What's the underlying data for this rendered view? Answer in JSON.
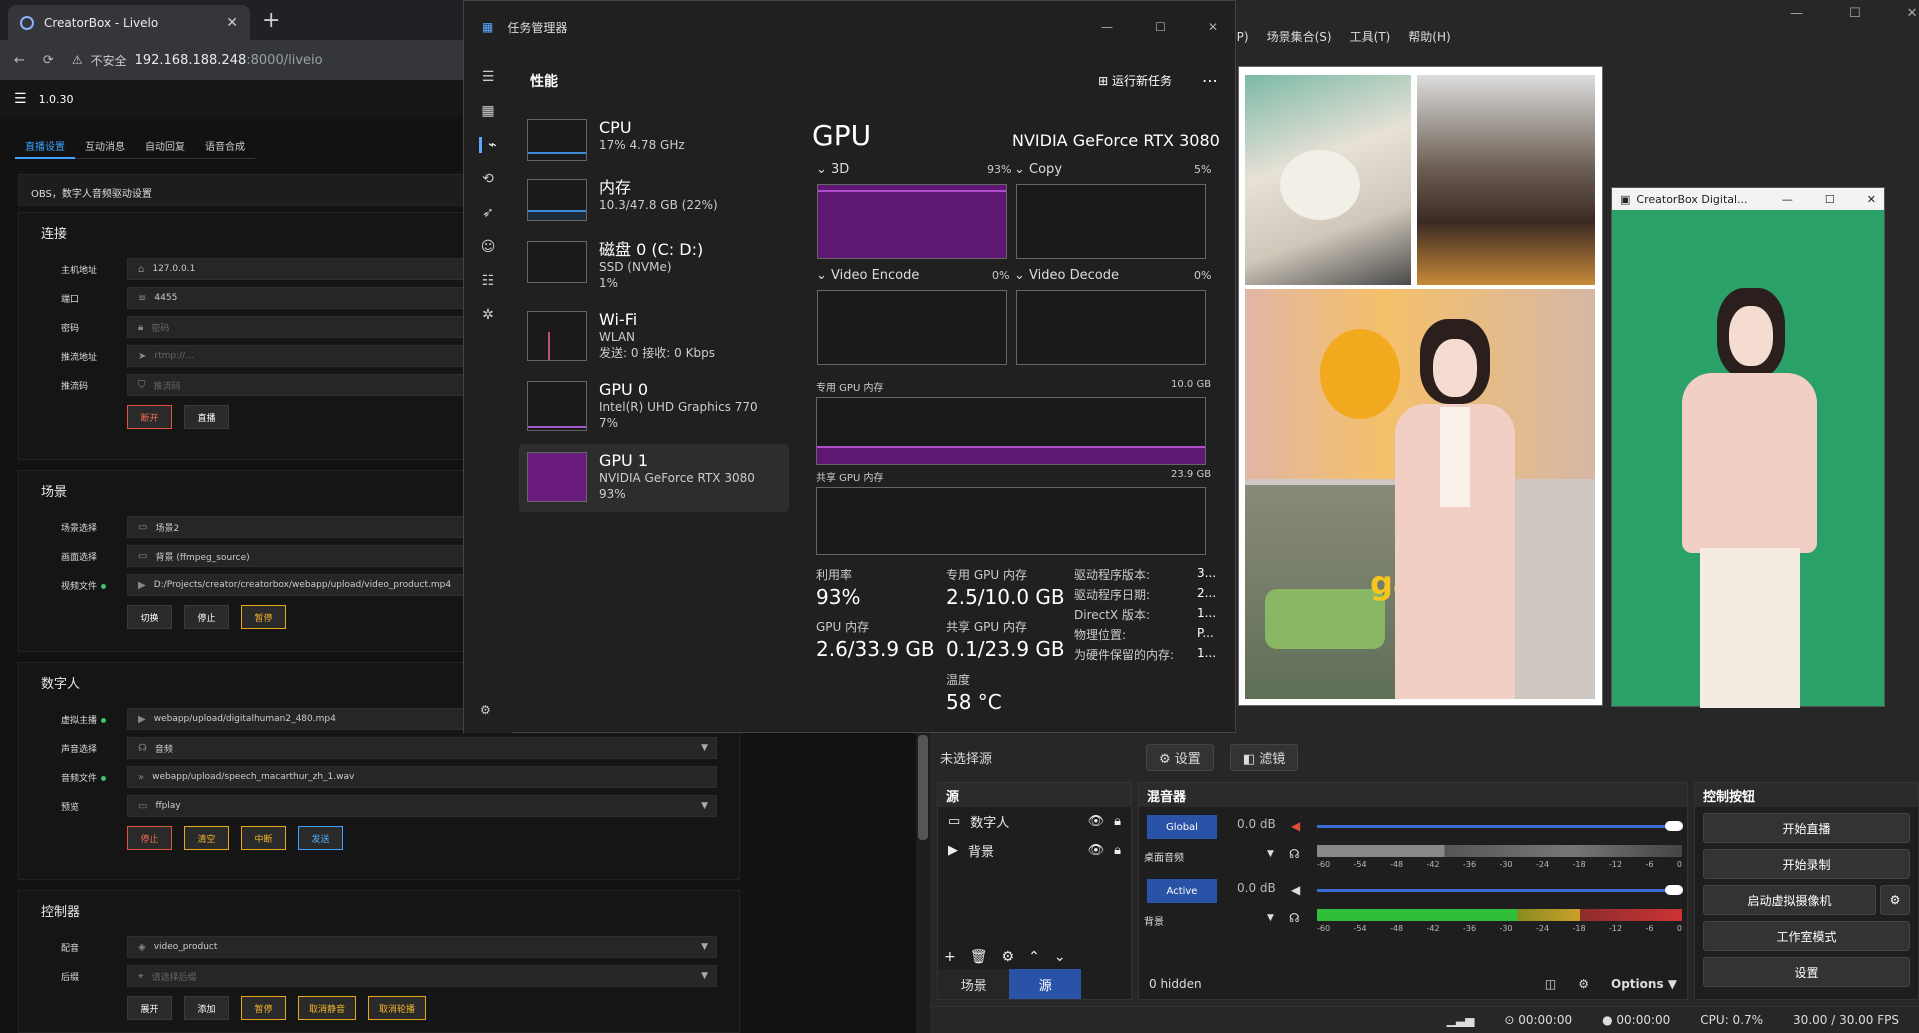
{
  "browser": {
    "tab_title": "CreatorBox - Livelo",
    "address_warning": "不安全",
    "address_host": "192.168.188.248",
    "address_path": ":8000/liveio"
  },
  "app": {
    "version": "1.0.30",
    "tabs": [
      "直播设置",
      "互动消息",
      "自动回复",
      "语音合成"
    ],
    "obs_note": "OBS，数字人音频驱动设置",
    "connection": {
      "title": "连接",
      "host_label": "主机地址",
      "host_value": "127.0.0.1",
      "port_label": "端口",
      "port_value": "4455",
      "password_label": "密码",
      "password_placeholder": "密码",
      "push_url_label": "推流地址",
      "push_url_placeholder": "rtmp://...",
      "push_code_label": "推流码",
      "push_code_placeholder": "推流码",
      "btn_disconnect": "断开",
      "btn_live": "直播"
    },
    "scene": {
      "title": "场景",
      "scene_select_label": "场景选择",
      "scene_select_value": "场景2",
      "frame_select_label": "画面选择",
      "frame_select_value": "背景 (ffmpeg_source)",
      "video_file_label": "视频文件",
      "video_file_value": "D:/Projects/creator/creatorbox/webapp/upload/video_product.mp4",
      "btn_switch": "切换",
      "btn_stop": "停止",
      "btn_pause": "暂停"
    },
    "digital_human": {
      "title": "数字人",
      "anchor_label": "虚拟主播",
      "anchor_value": "webapp/upload/digitalhuman2_480.mp4",
      "voice_label": "声音选择",
      "voice_value": "音频",
      "audio_file_label": "音频文件",
      "audio_file_value": "webapp/upload/speech_macarthur_zh_1.wav",
      "preview_label": "预览",
      "preview_value": "ffplay",
      "btn_stop": "停止",
      "btn_clear": "清空",
      "btn_interrupt": "中断",
      "btn_send": "发送"
    },
    "controller": {
      "title": "控制器",
      "dub_label": "配音",
      "dub_value": "video_product",
      "bg_label": "后缀",
      "bg_placeholder": "请选择后缀",
      "btn_expand": "展开",
      "btn_add": "添加",
      "btn_pause": "暂停",
      "btn_unmute": "取消静音",
      "btn_cancel_loop": "取消轮播"
    }
  },
  "obs": {
    "menu": [
      "件(P)",
      "场景集合(S)",
      "工具(T)",
      "帮助(H)"
    ],
    "unselected_source": "未选择源",
    "btn_settings": "设置",
    "btn_filters": "滤镜",
    "sources_title": "源",
    "sources": [
      {
        "name": "数字人",
        "icon": "monitor-icon"
      },
      {
        "name": "背景",
        "icon": "play-icon"
      }
    ],
    "tab_scenes": "场景",
    "tab_sources": "源",
    "mixer_title": "混音器",
    "mixer": [
      {
        "badge": "Global",
        "db": "0.0 dB",
        "name": "桌面音频"
      },
      {
        "badge": "Active",
        "db": "0.0 dB",
        "name": "背景"
      }
    ],
    "meter_scale": [
      "-60",
      "-54",
      "-48",
      "-42",
      "-36",
      "-30",
      "-24",
      "-18",
      "-12",
      "-6",
      "0"
    ],
    "hidden_count": "0 hidden",
    "options_label": "Options",
    "controls_title": "控制按钮",
    "controls": [
      "开始直播",
      "开始录制",
      "启动虚拟摄像机",
      "工作室模式",
      "设置"
    ],
    "status": {
      "stream_time": "00:00:00",
      "rec_time": "00:00:00",
      "cpu": "CPU: 0.7%",
      "fps": "30.00 / 30.00 FPS"
    },
    "vcam_title": "CreatorBox Digital...",
    "preview_overlay_text": "gad"
  },
  "taskmanager": {
    "title": "任务管理器",
    "section": "性能",
    "run_new_task": "运行新任务",
    "items": [
      {
        "name": "CPU",
        "sub1": "17% 4.78 GHz",
        "sub2": ""
      },
      {
        "name": "内存",
        "sub1": "10.3/47.8 GB (22%)",
        "sub2": ""
      },
      {
        "name": "磁盘 0 (C: D:)",
        "sub1": "SSD (NVMe)",
        "sub2": "1%"
      },
      {
        "name": "Wi-Fi",
        "sub1": "WLAN",
        "sub2": "发送: 0 接收: 0 Kbps"
      },
      {
        "name": "GPU 0",
        "sub1": "Intel(R) UHD Graphics 770",
        "sub2": "7%"
      },
      {
        "name": "GPU 1",
        "sub1": "NVIDIA GeForce RTX 3080",
        "sub2": "93%"
      }
    ],
    "gpu_heading": "GPU",
    "gpu_model": "NVIDIA GeForce RTX 3080",
    "engines": [
      {
        "name": "3D",
        "pct": "93%"
      },
      {
        "name": "Copy",
        "pct": "5%"
      },
      {
        "name": "Video Encode",
        "pct": "0%"
      },
      {
        "name": "Video Decode",
        "pct": "0%"
      }
    ],
    "dedicated_label": "专用 GPU 内存",
    "dedicated_max": "10.0 GB",
    "shared_label": "共享 GPU 内存",
    "shared_max": "23.9 GB",
    "stats": {
      "util_label": "利用率",
      "util_value": "93%",
      "ded_label": "专用 GPU 内存",
      "ded_value": "2.5/10.0 GB",
      "gpumem_label": "GPU 内存",
      "gpumem_value": "2.6/33.9 GB",
      "shared_label": "共享 GPU 内存",
      "shared_value": "0.1/23.9 GB",
      "temp_label": "温度",
      "temp_value": "58 °C",
      "driver_ver_label": "驱动程序版本:",
      "driver_ver_value": "3...",
      "driver_date_label": "驱动程序日期:",
      "driver_date_value": "2...",
      "directx_label": "DirectX 版本:",
      "directx_value": "1...",
      "location_label": "物理位置:",
      "location_value": "P...",
      "reserved_label": "为硬件保留的内存:",
      "reserved_value": "1..."
    }
  },
  "colors": {
    "accent_blue": "#3da2ff",
    "gpu_purple": "#7b1fa2",
    "green_screen": "#2aa168",
    "obs_blue": "#2a52a6"
  }
}
